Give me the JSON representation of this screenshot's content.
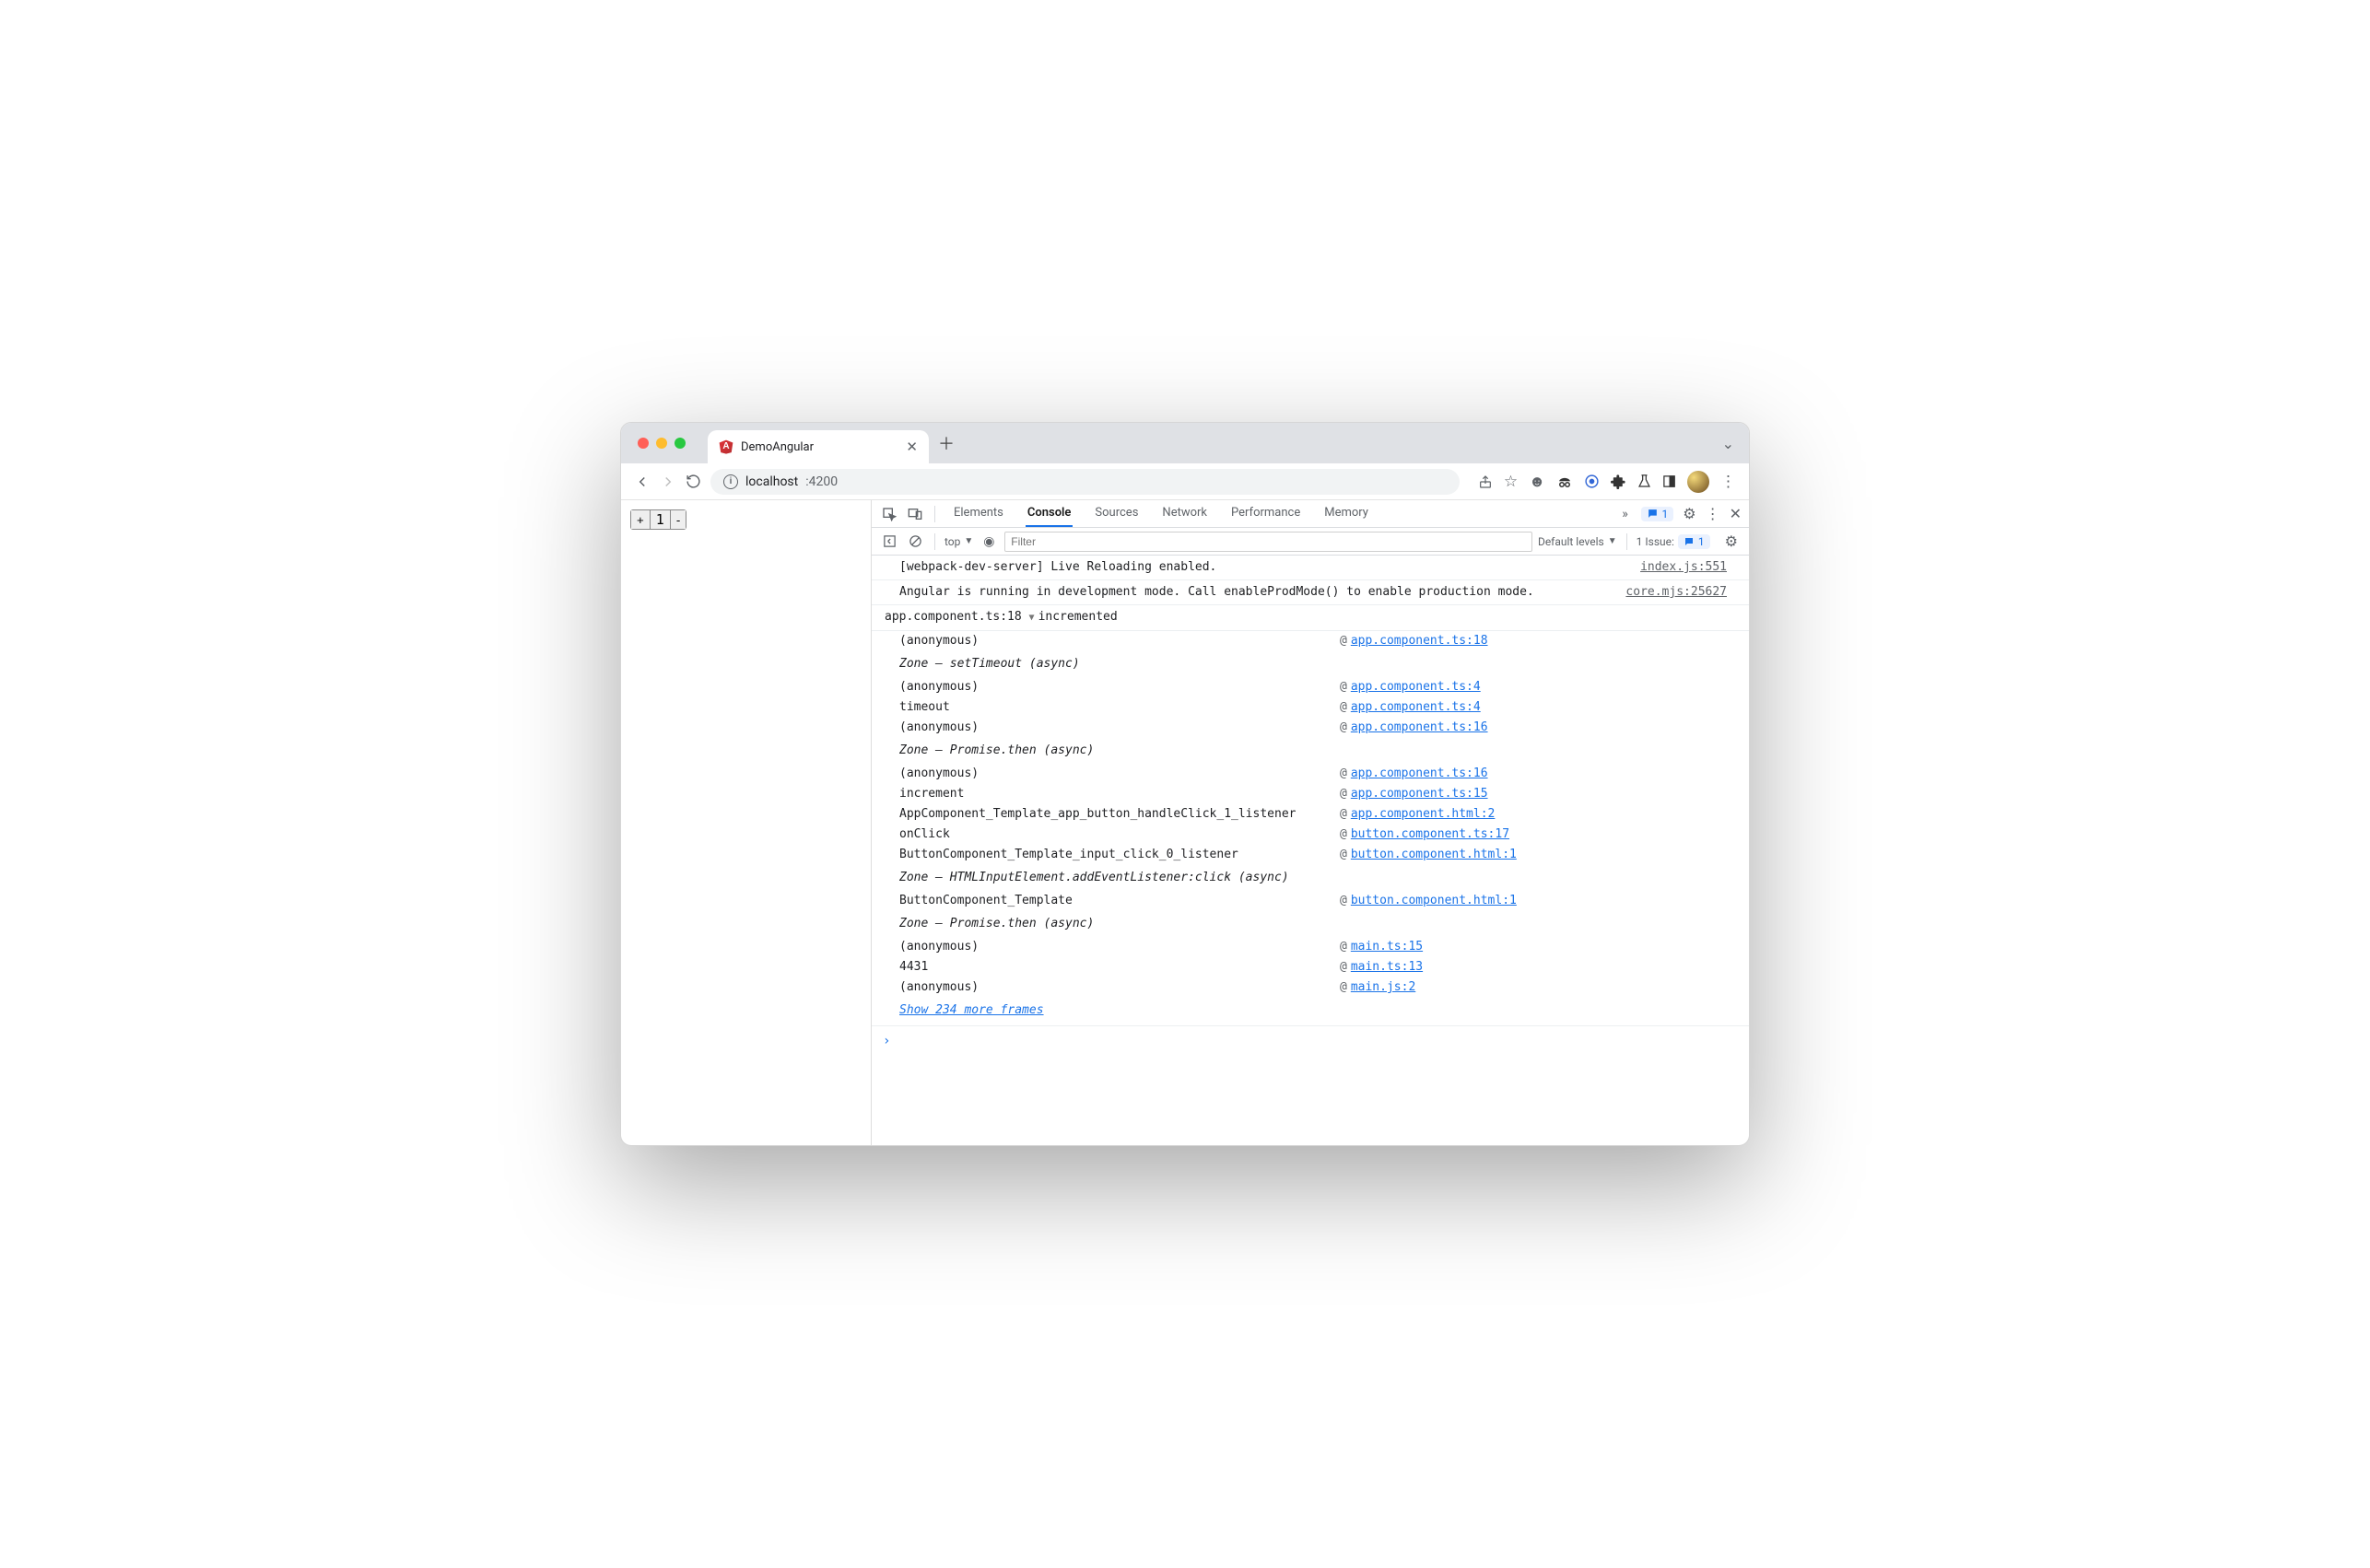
{
  "tab": {
    "title": "DemoAngular"
  },
  "url": {
    "host": "localhost",
    "port": ":4200"
  },
  "page": {
    "plus": "+",
    "value": "1",
    "minus": "-"
  },
  "devtools": {
    "tabs": [
      "Elements",
      "Console",
      "Sources",
      "Network",
      "Performance",
      "Memory"
    ],
    "moreTabs": "»",
    "messagesBadge": "1",
    "context": "top",
    "filterPlaceholder": "Filter",
    "levels": "Default levels",
    "issuesLabel": "1 Issue:",
    "issuesCount": "1"
  },
  "logs": [
    {
      "text": "[webpack-dev-server] Live Reloading enabled.",
      "source": "index.js:551"
    },
    {
      "text": "Angular is running in development mode. Call enableProdMode() to enable production mode.",
      "source": "core.mjs:25627"
    }
  ],
  "trace": {
    "head": "incremented",
    "source": "app.component.ts:18",
    "frames": [
      {
        "fn": "(anonymous)",
        "link": "app.component.ts:18"
      },
      {
        "async": "Zone — setTimeout (async)"
      },
      {
        "fn": "(anonymous)",
        "link": "app.component.ts:4"
      },
      {
        "fn": "timeout",
        "link": "app.component.ts:4"
      },
      {
        "fn": "(anonymous)",
        "link": "app.component.ts:16"
      },
      {
        "async": "Zone — Promise.then (async)"
      },
      {
        "fn": "(anonymous)",
        "link": "app.component.ts:16"
      },
      {
        "fn": "increment",
        "link": "app.component.ts:15"
      },
      {
        "fn": "AppComponent_Template_app_button_handleClick_1_listener",
        "link": "app.component.html:2"
      },
      {
        "fn": "onClick",
        "link": "button.component.ts:17"
      },
      {
        "fn": "ButtonComponent_Template_input_click_0_listener",
        "link": "button.component.html:1"
      },
      {
        "async": "Zone — HTMLInputElement.addEventListener:click (async)"
      },
      {
        "fn": "ButtonComponent_Template",
        "link": "button.component.html:1"
      },
      {
        "async": "Zone — Promise.then (async)"
      },
      {
        "fn": "(anonymous)",
        "link": "main.ts:15"
      },
      {
        "fn": "4431",
        "link": "main.ts:13"
      },
      {
        "fn": "(anonymous)",
        "link": "main.js:2"
      }
    ],
    "showMore": "Show 234 more frames"
  }
}
